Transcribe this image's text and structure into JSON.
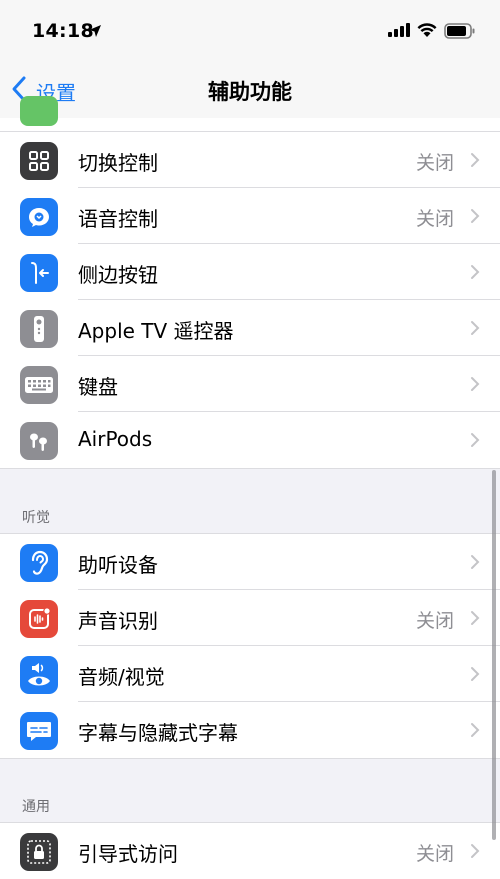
{
  "status_bar": {
    "time": "14:18"
  },
  "nav": {
    "back_label": "设置",
    "title": "辅助功能"
  },
  "groups": [
    {
      "header": "",
      "items": [
        {
          "label": "切换控制",
          "value": "关闭",
          "icon": "switch-control-icon",
          "color": "#3a3a3c"
        },
        {
          "label": "语音控制",
          "value": "关闭",
          "icon": "voice-control-icon",
          "color": "#1e7cf4"
        },
        {
          "label": "侧边按钮",
          "value": "",
          "icon": "side-button-icon",
          "color": "#1e7cf4"
        },
        {
          "label": "Apple TV 遥控器",
          "value": "",
          "icon": "remote-icon",
          "color": "#8e8e93"
        },
        {
          "label": "键盘",
          "value": "",
          "icon": "keyboard-icon",
          "color": "#8e8e93"
        },
        {
          "label": "AirPods",
          "value": "",
          "icon": "airpods-icon",
          "color": "#8e8e93"
        }
      ]
    },
    {
      "header": "听觉",
      "items": [
        {
          "label": "助听设备",
          "value": "",
          "icon": "ear-icon",
          "color": "#1e7cf4"
        },
        {
          "label": "声音识别",
          "value": "关闭",
          "icon": "sound-recognition-icon",
          "color": "#e5493a"
        },
        {
          "label": "音频/视觉",
          "value": "",
          "icon": "audio-visual-icon",
          "color": "#1e7cf4"
        },
        {
          "label": "字幕与隐藏式字幕",
          "value": "",
          "icon": "subtitles-icon",
          "color": "#1e7cf4"
        }
      ]
    },
    {
      "header": "通用",
      "items": [
        {
          "label": "引导式访问",
          "value": "关闭",
          "icon": "guided-access-icon",
          "color": "#3a3a3c"
        }
      ]
    }
  ]
}
